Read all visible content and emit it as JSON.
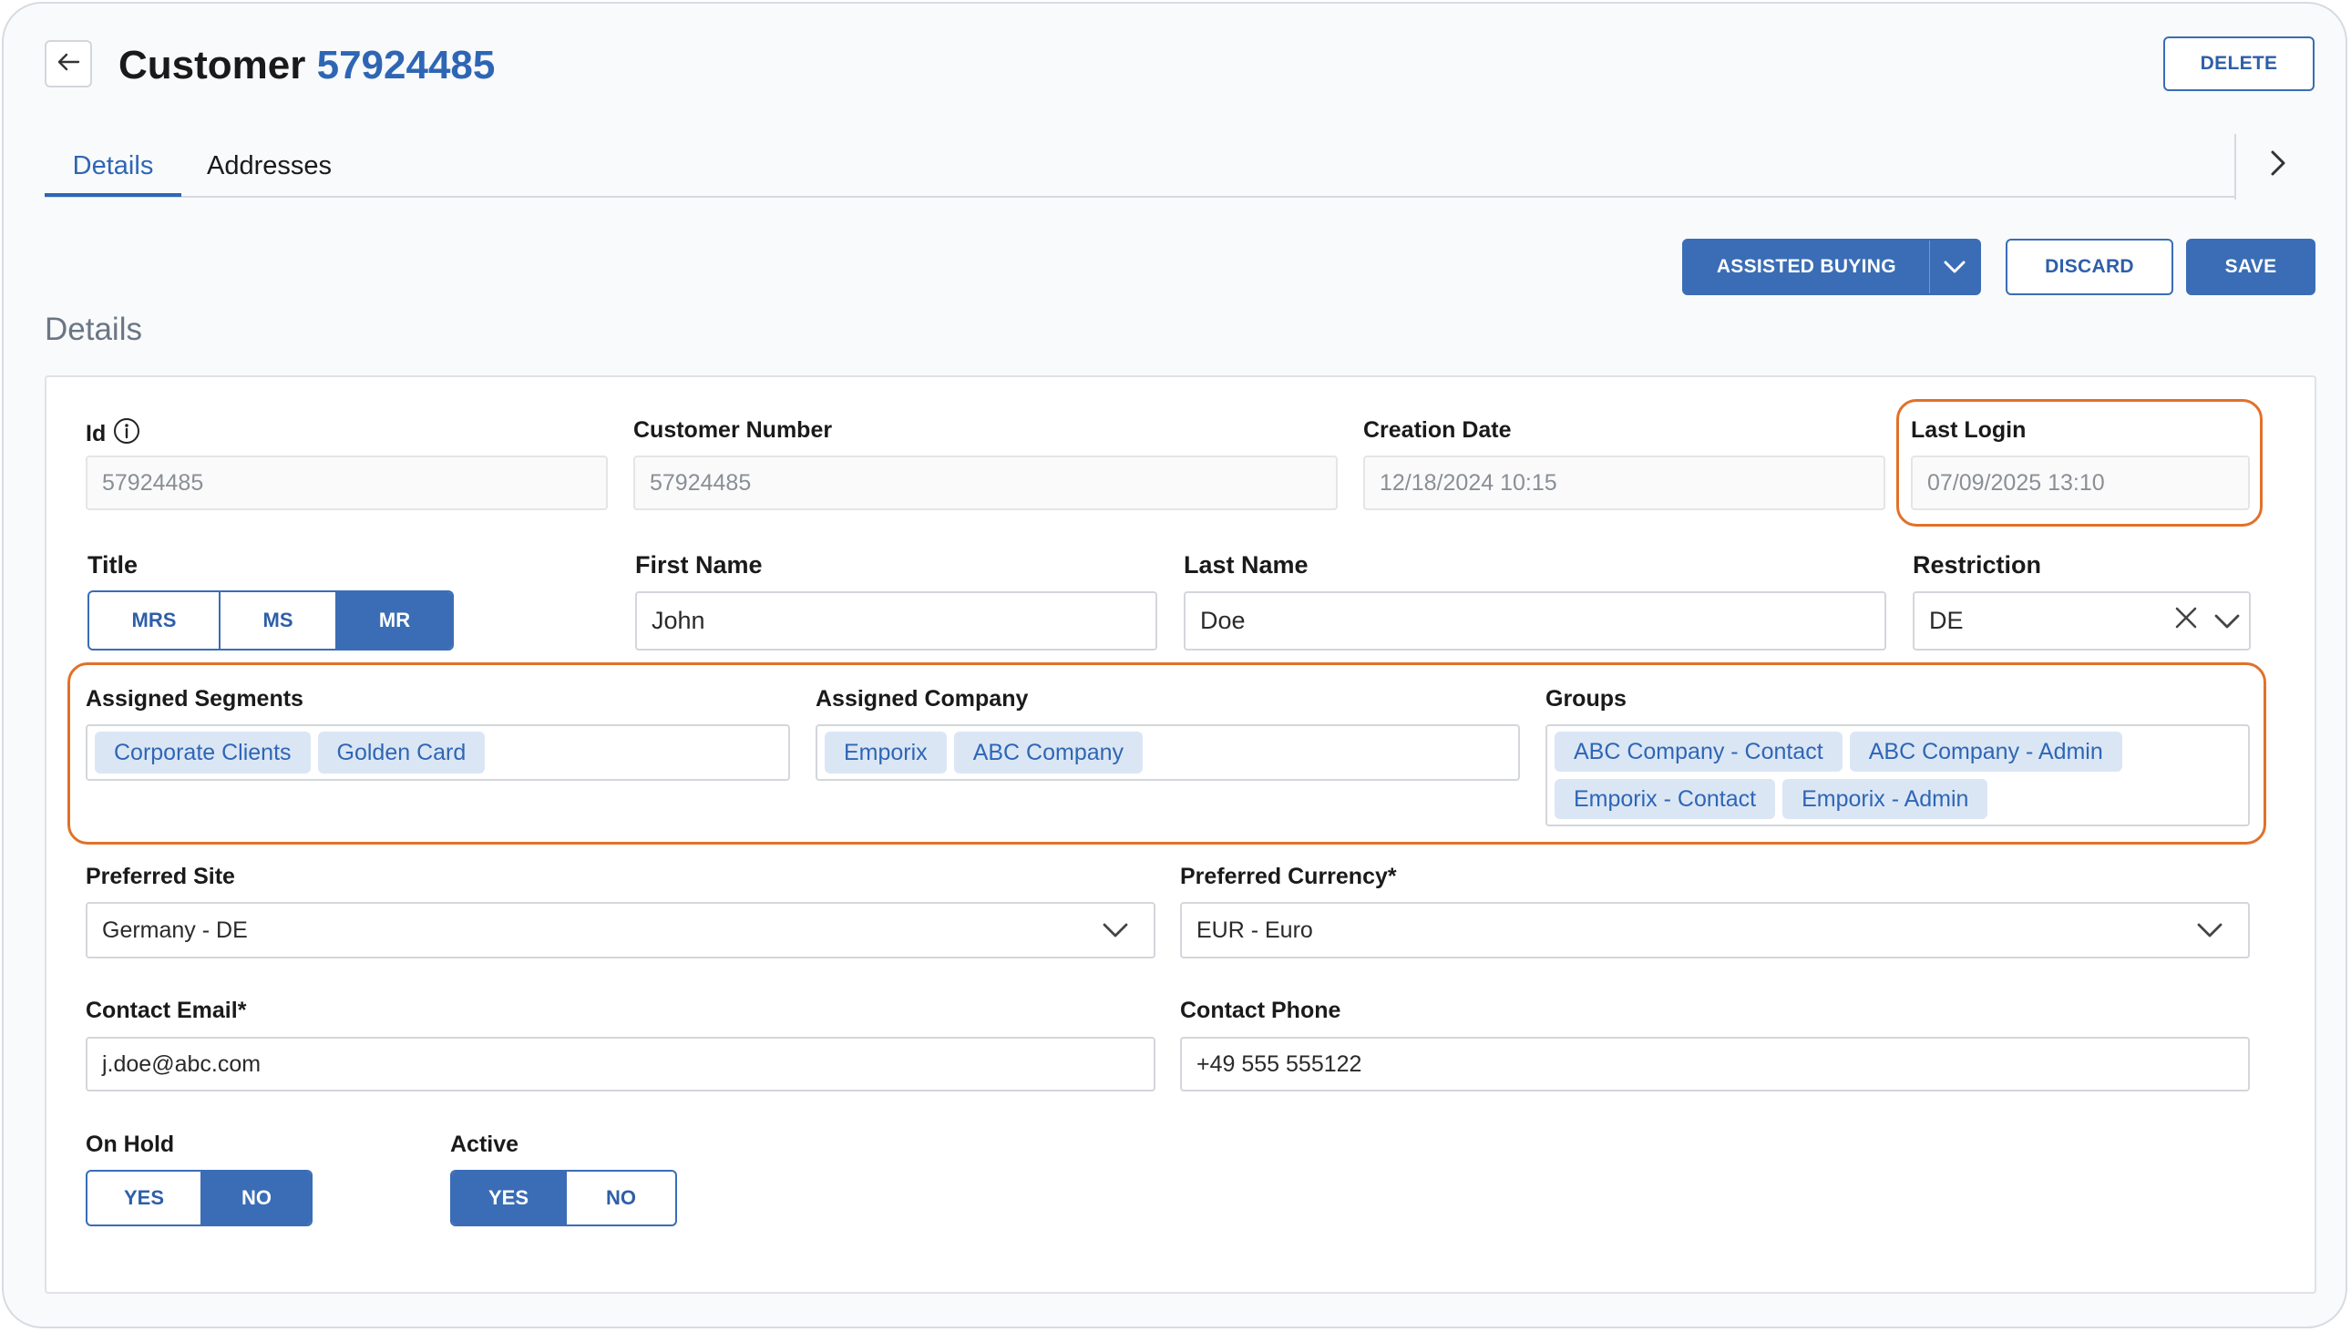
{
  "header": {
    "title": "Customer",
    "customer_number": "57924485",
    "delete_label": "DELETE"
  },
  "tabs": [
    {
      "label": "Details",
      "active": true
    },
    {
      "label": "Addresses",
      "active": false
    }
  ],
  "actions": {
    "assisted_buying_label": "ASSISTED BUYING",
    "discard_label": "DISCARD",
    "save_label": "SAVE"
  },
  "section_title": "Details",
  "form": {
    "id": {
      "label": "Id",
      "value": "57924485"
    },
    "customer_number": {
      "label": "Customer Number",
      "value": "57924485"
    },
    "creation_date": {
      "label": "Creation Date",
      "value": "12/18/2024 10:15"
    },
    "last_login": {
      "label": "Last Login",
      "value": "07/09/2025 13:10"
    },
    "title": {
      "label": "Title",
      "options": [
        "MRS",
        "MS",
        "MR"
      ],
      "selected": "MR"
    },
    "first_name": {
      "label": "First Name",
      "value": "John"
    },
    "last_name": {
      "label": "Last Name",
      "value": "Doe"
    },
    "restriction": {
      "label": "Restriction",
      "value": "DE"
    },
    "assigned_segments": {
      "label": "Assigned Segments",
      "chips": [
        "Corporate Clients",
        "Golden Card"
      ]
    },
    "assigned_company": {
      "label": "Assigned Company",
      "chips": [
        "Emporix",
        "ABC Company"
      ]
    },
    "groups": {
      "label": "Groups",
      "chips": [
        "ABC Company - Contact",
        "ABC Company - Admin",
        "Emporix - Contact",
        "Emporix - Admin"
      ]
    },
    "preferred_site": {
      "label": "Preferred Site",
      "value": "Germany - DE"
    },
    "preferred_currency": {
      "label": "Preferred Currency*",
      "value": "EUR - Euro"
    },
    "contact_email": {
      "label": "Contact Email*",
      "value": "j.doe@abc.com"
    },
    "contact_phone": {
      "label": "Contact Phone",
      "value": "+49 555 555122"
    },
    "on_hold": {
      "label": "On Hold",
      "options": [
        "YES",
        "NO"
      ],
      "selected": "NO"
    },
    "active": {
      "label": "Active",
      "options": [
        "YES",
        "NO"
      ],
      "selected": "YES"
    }
  },
  "colors": {
    "primary": "#3a6db5",
    "link": "#2e66b5",
    "highlight": "#e0712a",
    "chip_bg": "#dbe6f5"
  }
}
